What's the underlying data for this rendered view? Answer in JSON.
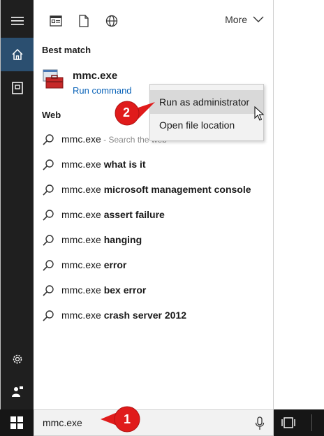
{
  "left_rail": {
    "items": [
      {
        "icon": "hamburger-icon"
      },
      {
        "icon": "home-icon",
        "active": true
      },
      {
        "icon": "notebook-icon"
      },
      {
        "icon": "gear-icon"
      },
      {
        "icon": "user-feedback-icon"
      }
    ]
  },
  "topbar": {
    "icons": [
      "apps-icon",
      "document-icon",
      "globe-icon"
    ],
    "more_label": "More"
  },
  "best_match": {
    "heading": "Best match",
    "app_name": "mmc.exe",
    "app_subtitle": "Run command",
    "icon": "toolbox-icon"
  },
  "web": {
    "heading": "Web",
    "results": [
      {
        "prefix": "mmc.exe",
        "bold": "",
        "hint": " - Search the web"
      },
      {
        "prefix": "mmc.exe ",
        "bold": "what is it",
        "hint": ""
      },
      {
        "prefix": "mmc.exe ",
        "bold": "microsoft management console",
        "hint": ""
      },
      {
        "prefix": "mmc.exe ",
        "bold": "assert failure",
        "hint": ""
      },
      {
        "prefix": "mmc.exe ",
        "bold": "hanging",
        "hint": ""
      },
      {
        "prefix": "mmc.exe ",
        "bold": "error",
        "hint": ""
      },
      {
        "prefix": "mmc.exe ",
        "bold": "bex error",
        "hint": ""
      },
      {
        "prefix": "mmc.exe ",
        "bold": "crash server 2012",
        "hint": ""
      }
    ]
  },
  "context_menu": {
    "items": [
      {
        "label": "Run as administrator",
        "highlighted": true
      },
      {
        "label": "Open file location",
        "highlighted": false
      }
    ]
  },
  "search_box": {
    "value": "mmc.exe"
  },
  "callouts": [
    {
      "number": "2",
      "color": "#e01b1b"
    },
    {
      "number": "1",
      "color": "#e01b1b"
    }
  ],
  "colors": {
    "rail_bg": "#1f1f1f",
    "active_accent": "#2b4f70",
    "link": "#0a63b8",
    "callout_red": "#e01b1b"
  }
}
